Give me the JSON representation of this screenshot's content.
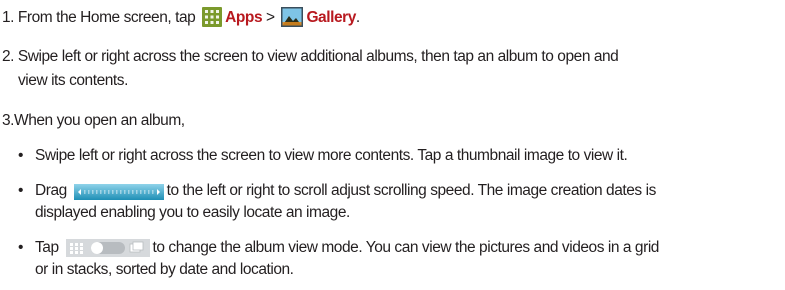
{
  "steps": [
    {
      "number": "1.",
      "text_before": "From the Home screen, tap",
      "apps_icon": "apps-grid-icon",
      "apps_label": "Apps",
      "separator": ">",
      "gallery_icon": "gallery-icon",
      "gallery_label": "Gallery",
      "text_after": "."
    },
    {
      "number": "2.",
      "line1": "Swipe left or right across the screen to view additional albums, then tap an album to open and",
      "line2": "view its contents."
    },
    {
      "number": "3.",
      "text": "When you open an album,"
    }
  ],
  "bullets": [
    {
      "symbol": "•",
      "line1": "Swipe left or right across the screen to view more contents. Tap a thumbnail image to view it."
    },
    {
      "symbol": "•",
      "prefix": "Drag",
      "icon": "scroll-bar-icon",
      "line1_rest": "to the left or right to scroll adjust scrolling speed. The image creation dates is",
      "line2": "displayed enabling you to easily locate an image."
    },
    {
      "symbol": "•",
      "prefix": "Tap",
      "icon": "view-mode-toggle-icon",
      "line1_rest": "to change the album view mode. You can view the pictures and videos in a grid",
      "line2": "or in stacks, sorted by date and location."
    }
  ],
  "colors": {
    "text": "#231f20",
    "accent_red": "#b8191f",
    "apps_icon_green": "#7b9a2c",
    "scrollbar_blue": "#2aa6c8",
    "toggle_grey": "#b8bcc0"
  }
}
